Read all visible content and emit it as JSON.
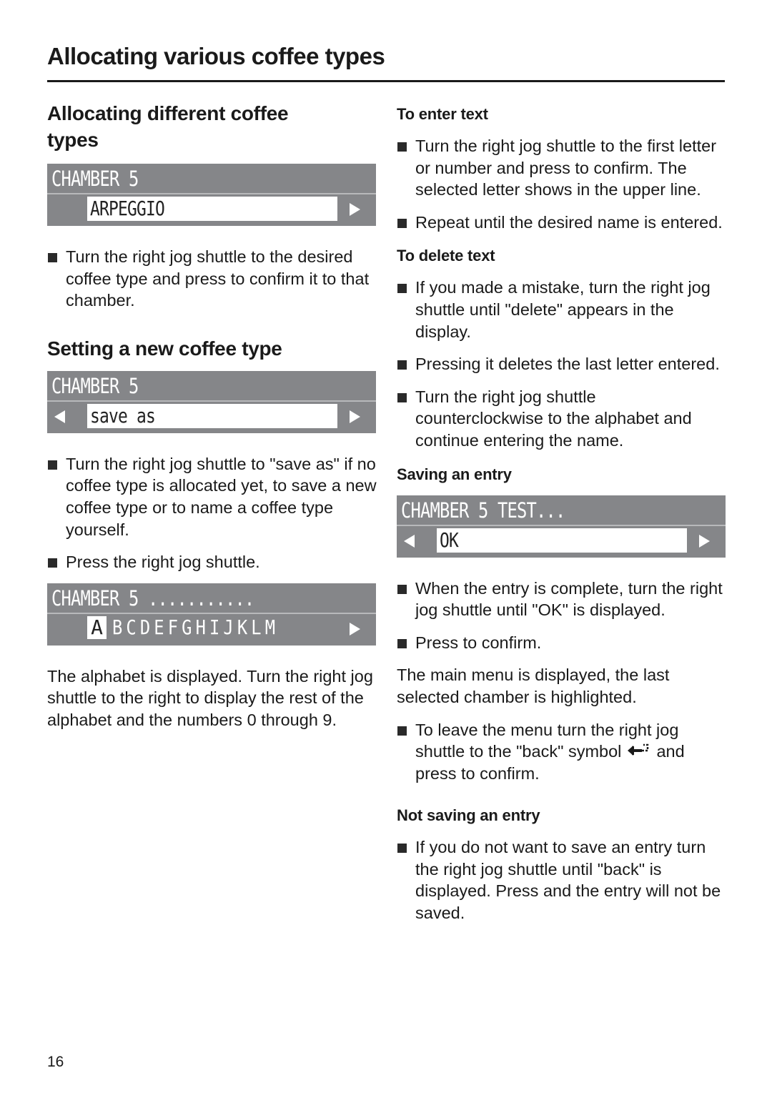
{
  "page": {
    "title": "Allocating various coffee types",
    "page_number": "16"
  },
  "left": {
    "section1": {
      "heading": "Allocating different coffee types",
      "display": {
        "top": "CHAMBER 5",
        "field": "ARPEGGIO",
        "right_arrow": true,
        "left_arrow": false
      },
      "bullets": [
        "Turn the right jog shuttle to the desired coffee type and press to confirm it to that chamber."
      ]
    },
    "section2": {
      "heading": "Setting a new coffee type",
      "display": {
        "top": "CHAMBER 5",
        "field": "save as",
        "right_arrow": true,
        "left_arrow": true
      },
      "bullets": [
        "Turn the right jog shuttle to \"save as\" if no coffee type is allocated yet, to save a new coffee type or to name a coffee type yourself.",
        "Press the right jog shuttle."
      ],
      "display2": {
        "top": "CHAMBER 5 ...........",
        "selected_letter": "A",
        "letters": "BCDEFGHIJKLM"
      },
      "paragraph": "The alphabet is displayed. Turn the right jog shuttle to the right to display the rest of the alphabet and the numbers 0 through 9."
    }
  },
  "right": {
    "enter_text": {
      "heading": "To enter text",
      "bullets": [
        "Turn the right jog shuttle to the first letter or number and press to confirm. The selected letter shows in the upper line.",
        "Repeat until the desired name is entered."
      ]
    },
    "delete_text": {
      "heading": "To delete text",
      "bullets": [
        "If you made a mistake, turn the right jog shuttle until \"delete\" appears in the display.",
        "Pressing it deletes the last letter entered.",
        "Turn the right jog shuttle counterclockwise to the alphabet and continue entering the name."
      ]
    },
    "saving": {
      "heading": "Saving an entry",
      "display": {
        "top": "CHAMBER 5  TEST...",
        "field": "OK"
      },
      "bullets": [
        "When the entry is complete, turn the right jog shuttle until \"OK\" is displayed.",
        "Press to confirm."
      ],
      "paragraph": "The main menu is displayed, the last selected chamber is highlighted.",
      "back_bullet_before": "To leave the menu turn the right jog shuttle to the \"back\" symbol",
      "back_bullet_after": "and press to confirm."
    },
    "not_saving": {
      "heading": "Not saving an entry",
      "bullets": [
        "If you do not want to save an entry turn the right jog shuttle until \"back\" is displayed. Press and the entry will not be saved."
      ]
    }
  }
}
